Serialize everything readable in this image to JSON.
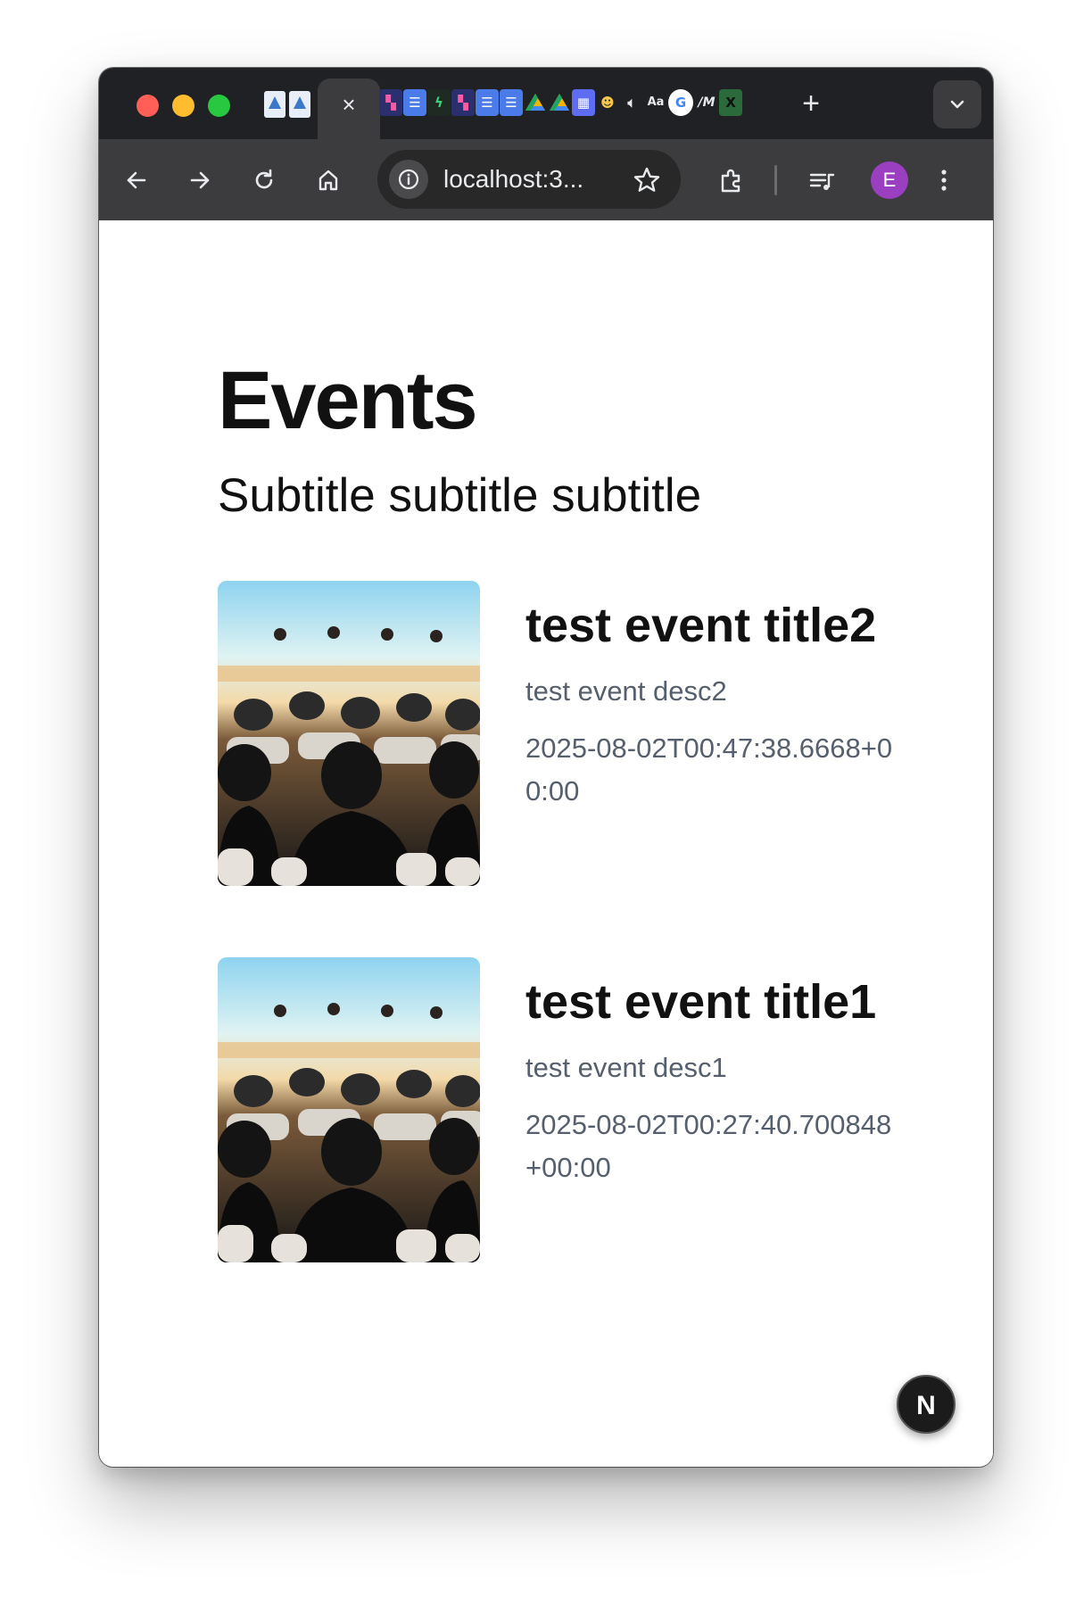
{
  "browser": {
    "active_tab_close": "×",
    "new_tab": "+",
    "url": "localhost:3...",
    "profile_initial": "E"
  },
  "page": {
    "title": "Events",
    "subtitle": "Subtitle subtitle subtitle"
  },
  "events": [
    {
      "title": "test event title2",
      "description": "test event desc2",
      "date": "2025-08-02T00:47:38.6668+00:00"
    },
    {
      "title": "test event title1",
      "description": "test event desc1",
      "date": "2025-08-02T00:27:40.700848+00:00"
    }
  ],
  "next_badge": "N",
  "colors": {
    "tabstrip": "#202124",
    "toolbar": "#3c3c3f",
    "avatar": "#9b3fc1",
    "muted_text": "#555f6d"
  }
}
